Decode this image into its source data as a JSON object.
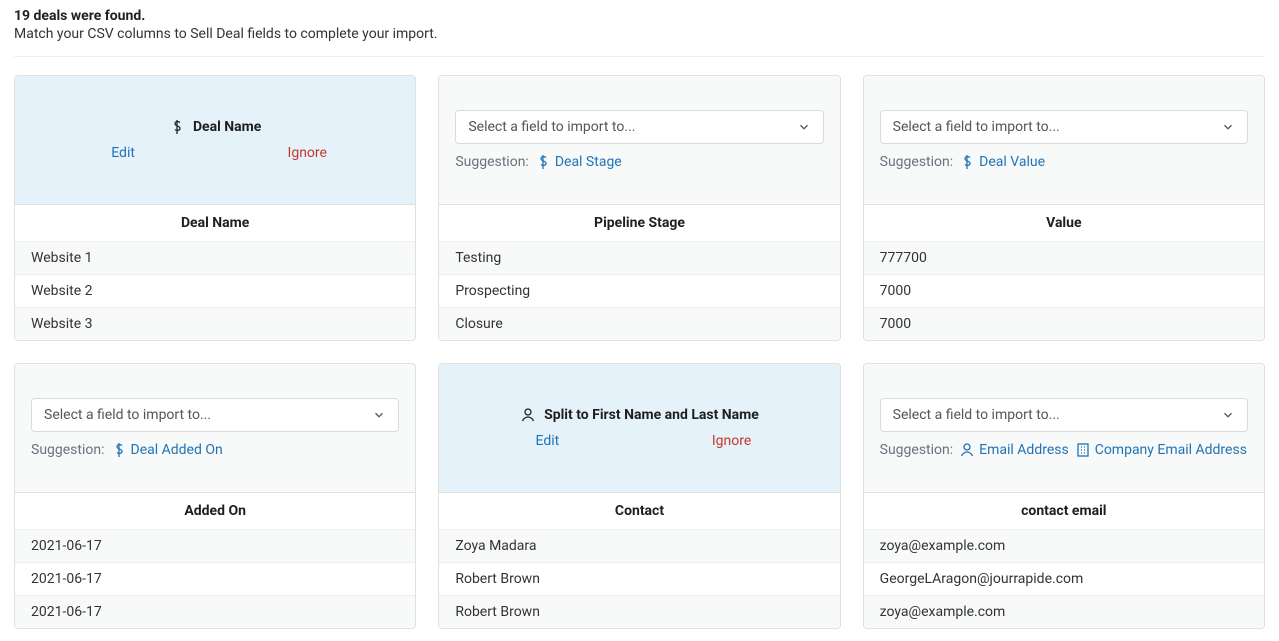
{
  "header": {
    "title": "19 deals were found.",
    "subtitle": "Match your CSV columns to Sell Deal fields to complete your import."
  },
  "select_placeholder": "Select a field to import to...",
  "suggestion_label": "Suggestion:",
  "actions": {
    "edit": "Edit",
    "ignore": "Ignore"
  },
  "cards": [
    {
      "state": "mapped",
      "mapped_field": "Deal Name",
      "mapped_icon": "deal",
      "column_header": "Deal Name",
      "rows": [
        "Website 1",
        "Website 2",
        "Website 3"
      ]
    },
    {
      "state": "unmapped",
      "suggestions": [
        {
          "icon": "deal",
          "label": "Deal Stage"
        }
      ],
      "column_header": "Pipeline Stage",
      "rows": [
        "Testing",
        "Prospecting",
        "Closure"
      ]
    },
    {
      "state": "unmapped",
      "suggestions": [
        {
          "icon": "deal",
          "label": "Deal Value"
        }
      ],
      "column_header": "Value",
      "rows": [
        "777700",
        "7000",
        "7000"
      ]
    },
    {
      "state": "unmapped",
      "suggestions": [
        {
          "icon": "deal",
          "label": "Deal Added On"
        }
      ],
      "column_header": "Added On",
      "rows": [
        "2021-06-17",
        "2021-06-17",
        "2021-06-17"
      ]
    },
    {
      "state": "mapped",
      "mapped_field": "Split to First Name and Last Name",
      "mapped_icon": "person",
      "column_header": "Contact",
      "rows": [
        "Zoya Madara",
        "Robert Brown",
        "Robert Brown"
      ]
    },
    {
      "state": "unmapped",
      "suggestions": [
        {
          "icon": "person",
          "label": "Email Address"
        },
        {
          "icon": "company",
          "label": "Company Email Address"
        }
      ],
      "column_header": "contact email",
      "rows": [
        "zoya@example.com",
        "GeorgeLAragon@jourrapide.com",
        "zoya@example.com"
      ]
    }
  ]
}
